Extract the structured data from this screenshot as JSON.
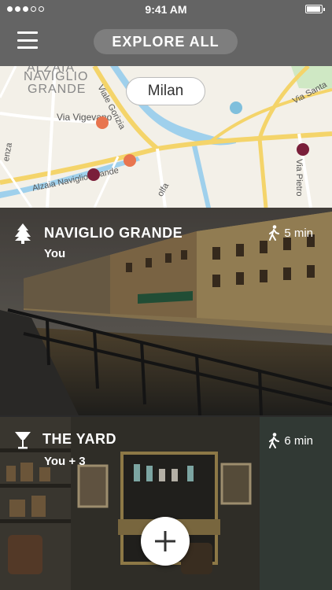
{
  "status": {
    "time": "9:41 AM",
    "signal_bars": 3,
    "battery_level": 0.9
  },
  "header": {
    "explore_label": "EXPLORE ALL"
  },
  "map": {
    "city": "Milan",
    "labels": [
      "NAVIGLIO",
      "GRANDE",
      "Viale Gorizia",
      "Via Vigevano",
      "Alzaia Naviglio Grande",
      "Via Santa",
      "Via Pietro",
      "olfa",
      "enza",
      "ALZAIA"
    ]
  },
  "places": [
    {
      "name": "NAVIGLIO GRANDE",
      "company": "You",
      "walk_time": "5 min",
      "category_icon": "tree-icon"
    },
    {
      "name": "THE YARD",
      "company": "You + 3",
      "walk_time": "6 min",
      "category_icon": "cocktail-glass-icon"
    }
  ],
  "colors": {
    "header": "#646464",
    "pin_orange": "#e8754f",
    "pin_maroon": "#7a1f3a",
    "pin_blue": "#7fbfdc"
  }
}
